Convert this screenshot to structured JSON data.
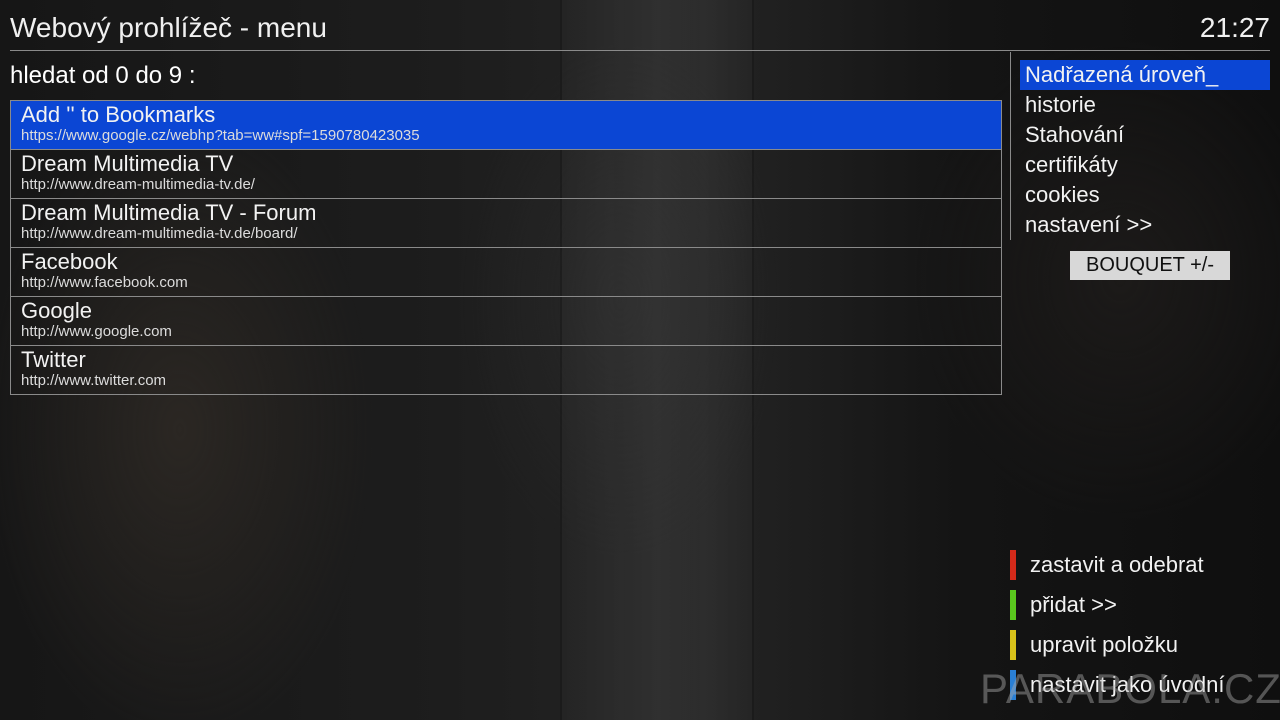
{
  "header": {
    "title": "Webový prohlížeč - menu",
    "clock": "21:27"
  },
  "search_label": "hledat od 0 do 9 :",
  "bookmarks": [
    {
      "name": "Add '' to Bookmarks",
      "url": "https://www.google.cz/webhp?tab=ww#spf=1590780423035",
      "selected": true
    },
    {
      "name": "Dream Multimedia TV",
      "url": "http://www.dream-multimedia-tv.de/",
      "selected": false
    },
    {
      "name": "Dream Multimedia TV - Forum",
      "url": "http://www.dream-multimedia-tv.de/board/",
      "selected": false
    },
    {
      "name": "Facebook",
      "url": "http://www.facebook.com",
      "selected": false
    },
    {
      "name": "Google",
      "url": "http://www.google.com",
      "selected": false
    },
    {
      "name": "Twitter",
      "url": "http://www.twitter.com",
      "selected": false
    }
  ],
  "side_menu": [
    {
      "label": "Nadřazená úroveň_",
      "selected": true
    },
    {
      "label": "historie",
      "selected": false
    },
    {
      "label": "Stahování",
      "selected": false
    },
    {
      "label": "certifikáty",
      "selected": false
    },
    {
      "label": "cookies",
      "selected": false
    },
    {
      "label": "nastavení >>",
      "selected": false
    }
  ],
  "bouquet_label": "BOUQUET +/-",
  "color_keys": [
    {
      "color": "#d42a1a",
      "label": "zastavit a odebrat"
    },
    {
      "color": "#5ac81e",
      "label": "přidat >>"
    },
    {
      "color": "#d9c21a",
      "label": "upravit položku"
    },
    {
      "color": "#2a7fd4",
      "label": "nastavit jako úvodní"
    }
  ],
  "watermark": "PARABOLA.CZ",
  "colors": {
    "highlight": "#0b46d4",
    "divider": "#8a8a8a"
  }
}
